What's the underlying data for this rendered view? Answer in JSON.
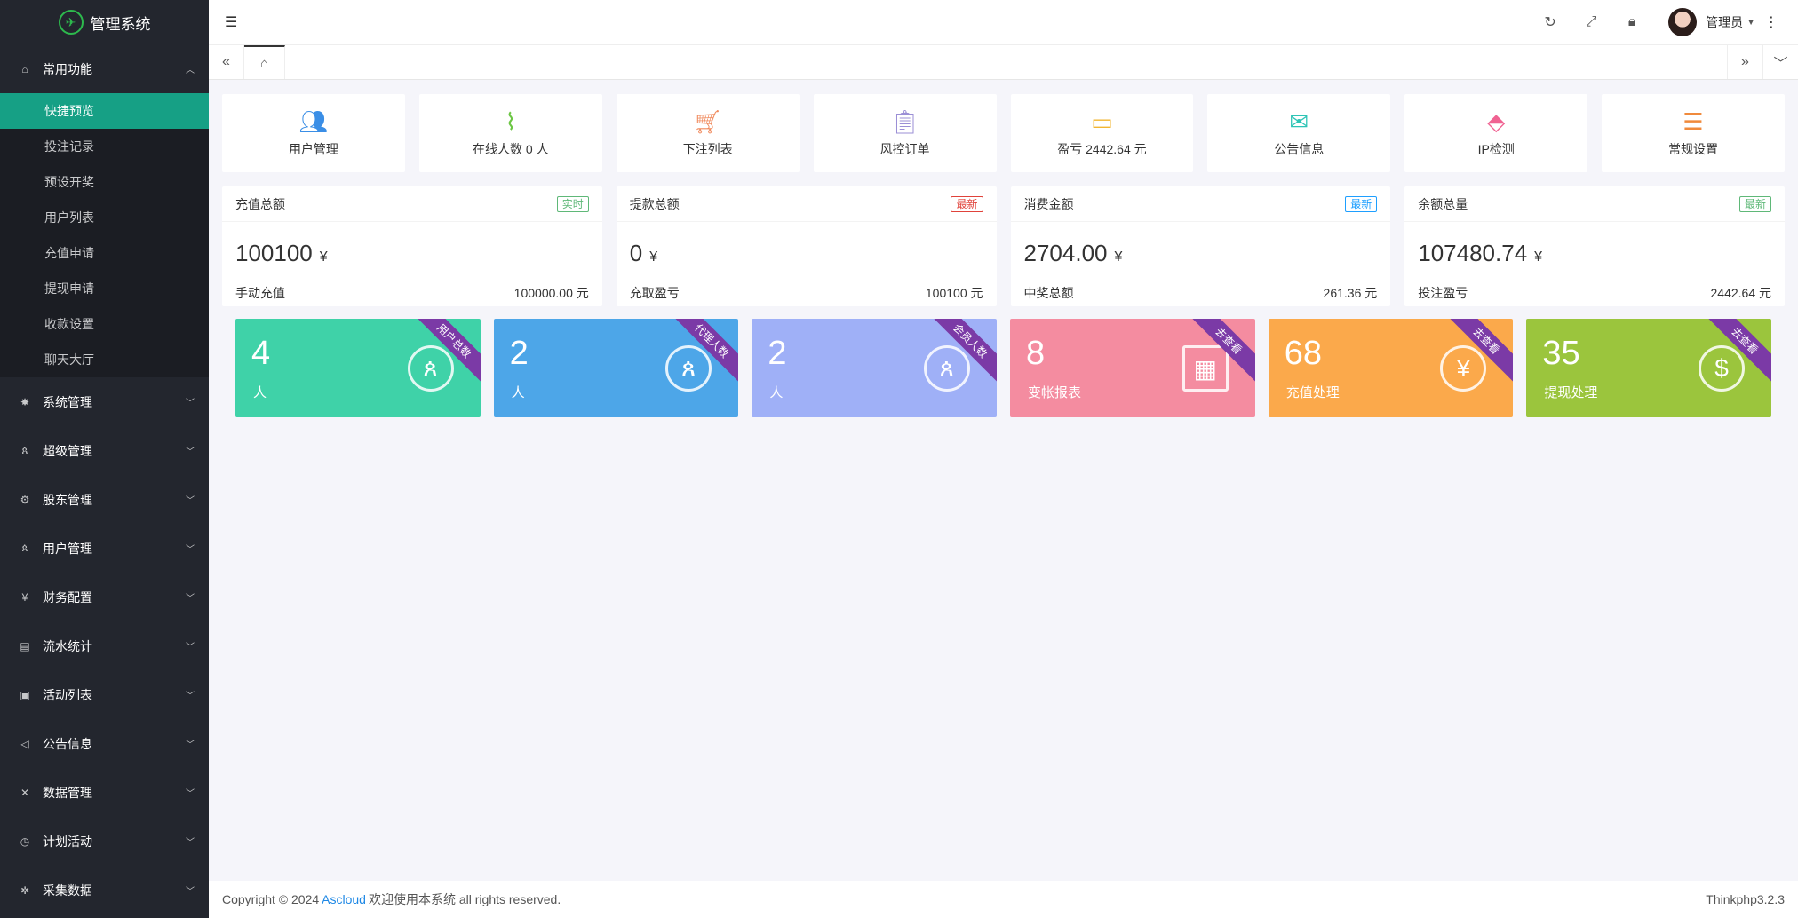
{
  "app": {
    "title": "管理系统"
  },
  "sidebar": {
    "groups": [
      {
        "label": "常用功能",
        "icon": "home-icon",
        "expanded": true,
        "items": [
          "快捷预览",
          "投注记录",
          "预设开奖",
          "用户列表",
          "充值申请",
          "提现申请",
          "收款设置",
          "聊天大厅"
        ],
        "active_index": 0
      },
      {
        "label": "系统管理",
        "icon": "gear-icon"
      },
      {
        "label": "超级管理",
        "icon": "user-icon"
      },
      {
        "label": "股东管理",
        "icon": "settings-icon"
      },
      {
        "label": "用户管理",
        "icon": "user-icon"
      },
      {
        "label": "财务配置",
        "icon": "yen-icon"
      },
      {
        "label": "流水统计",
        "icon": "list-icon"
      },
      {
        "label": "活动列表",
        "icon": "gift-icon"
      },
      {
        "label": "公告信息",
        "icon": "speaker-icon"
      },
      {
        "label": "数据管理",
        "icon": "tools-icon"
      },
      {
        "label": "计划活动",
        "icon": "clock-icon"
      },
      {
        "label": "采集数据",
        "icon": "bug-icon"
      }
    ]
  },
  "header": {
    "user_name": "管理员"
  },
  "shortcuts": [
    {
      "label": "用户管理",
      "icon": "users-icon",
      "color": "#3a8ee6"
    },
    {
      "label": "在线人数 0 人",
      "icon": "pulse-icon",
      "color": "#6cc644"
    },
    {
      "label": "下注列表",
      "icon": "cart-icon",
      "color": "#f08a5d"
    },
    {
      "label": "风控订单",
      "icon": "clipboard-icon",
      "color": "#9b8fd6"
    },
    {
      "label": "盈亏 2442.64 元",
      "icon": "card-icon",
      "color": "#f2b632"
    },
    {
      "label": "公告信息",
      "icon": "mail-icon",
      "color": "#2ec4b6"
    },
    {
      "label": "IP检测",
      "icon": "tag-icon",
      "color": "#f06292"
    },
    {
      "label": "常规设置",
      "icon": "sliders-icon",
      "color": "#f08a3c"
    }
  ],
  "stats": [
    {
      "title": "充值总额",
      "badge": "实时",
      "badge_color": "#5fb878",
      "value": "100100",
      "currency": "¥",
      "foot_label": "手动充值",
      "foot_value": "100000.00 元"
    },
    {
      "title": "提款总额",
      "badge": "最新",
      "badge_color": "#e0423a",
      "value": "0",
      "currency": "¥",
      "foot_label": "充取盈亏",
      "foot_value": "100100 元"
    },
    {
      "title": "消费金额",
      "badge": "最新",
      "badge_color": "#1e9fff",
      "value": "2704.00",
      "currency": "¥",
      "foot_label": "中奖总额",
      "foot_value": "261.36 元"
    },
    {
      "title": "余额总量",
      "badge": "最新",
      "badge_color": "#5fb878",
      "value": "107480.74",
      "currency": "¥",
      "foot_label": "投注盈亏",
      "foot_value": "2442.64 元"
    }
  ],
  "tiles": [
    {
      "number": "4",
      "label": "人",
      "ribbon": "用户总数",
      "icon": "user-icon",
      "color": "#3fd2a8"
    },
    {
      "number": "2",
      "label": "人",
      "ribbon": "代理人数",
      "icon": "user-icon",
      "color": "#4da6e8"
    },
    {
      "number": "2",
      "label": "人",
      "ribbon": "会员人数",
      "icon": "user-icon",
      "color": "#9fb0f7"
    },
    {
      "number": "8",
      "label": "变帐报表",
      "ribbon": "去查看",
      "icon": "calendar-icon",
      "color": "#f48ca0"
    },
    {
      "number": "68",
      "label": "充值处理",
      "ribbon": "去查看",
      "icon": "yen-icon",
      "color": "#fba94b"
    },
    {
      "number": "35",
      "label": "提现处理",
      "ribbon": "去查看",
      "icon": "dollar-icon",
      "color": "#9bc53d"
    }
  ],
  "footer": {
    "copyright": "Copyright © 2024",
    "link": "Ascloud",
    "text": "欢迎使用本系统 all rights reserved.",
    "version": "Thinkphp3.2.3"
  }
}
